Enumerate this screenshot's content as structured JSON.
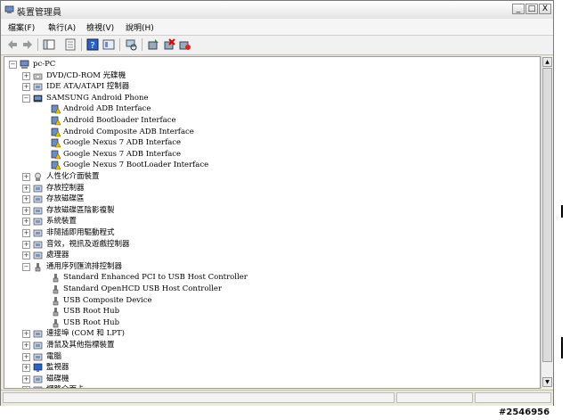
{
  "window": {
    "title": "裝置管理員",
    "buttons": {
      "minimize": "_",
      "maximize": "□",
      "close": "X"
    }
  },
  "menu": [
    {
      "label": "檔案(F)"
    },
    {
      "label": "執行(A)"
    },
    {
      "label": "檢視(V)"
    },
    {
      "label": "說明(H)"
    }
  ],
  "toolbar": [
    {
      "icon": "back-icon"
    },
    {
      "icon": "forward-icon"
    },
    {
      "icon": "console-tree-icon"
    },
    {
      "icon": "properties-list-icon"
    },
    {
      "icon": "help-icon"
    },
    {
      "icon": "view-icon"
    },
    {
      "icon": "scan-hardware-icon"
    },
    {
      "icon": "update-driver-icon"
    },
    {
      "icon": "uninstall-icon"
    },
    {
      "icon": "disable-icon"
    }
  ],
  "tree": {
    "root": "pc-PC",
    "items": [
      {
        "label": "DVD/CD-ROM 光碟機",
        "icon": "dvd-icon",
        "expander": "+"
      },
      {
        "label": "IDE ATA/ATAPI 控制器",
        "icon": "ide-icon",
        "expander": "+"
      },
      {
        "label": "SAMSUNG Android Phone",
        "icon": "phone-icon",
        "expander": "-"
      },
      {
        "label": "Android ADB Interface",
        "icon": "warning-device-icon",
        "child": true
      },
      {
        "label": "Android Bootloader Interface",
        "icon": "warning-device-icon",
        "child": true
      },
      {
        "label": "Android Composite ADB Interface",
        "icon": "warning-device-icon",
        "child": true
      },
      {
        "label": "Google Nexus 7 ADB Interface",
        "icon": "warning-device-icon",
        "child": true
      },
      {
        "label": "Google Nexus 7 ADB Interface",
        "icon": "warning-device-icon",
        "child": true
      },
      {
        "label": "Google Nexus 7 BootLoader Interface",
        "icon": "warning-device-icon",
        "child": true
      },
      {
        "label": "人性化介面裝置",
        "icon": "hid-icon",
        "expander": "+"
      },
      {
        "label": "存放控制器",
        "icon": "storage-controller-icon",
        "expander": "+"
      },
      {
        "label": "存放磁碟區",
        "icon": "volume-icon",
        "expander": "+"
      },
      {
        "label": "存放磁碟區陰影複製",
        "icon": "shadow-copy-icon",
        "expander": "+"
      },
      {
        "label": "系統裝置",
        "icon": "system-device-icon",
        "expander": "+"
      },
      {
        "label": "非隨插即用驅動程式",
        "icon": "driver-icon",
        "expander": "+"
      },
      {
        "label": "音效，視訊及遊戲控制器",
        "icon": "sound-icon",
        "expander": "+"
      },
      {
        "label": "處理器",
        "icon": "processor-icon",
        "expander": "+"
      },
      {
        "label": "通用序列匯流排控制器",
        "icon": "usb-icon",
        "expander": "-"
      },
      {
        "label": "Standard Enhanced PCI to USB Host Controller",
        "icon": "usb-icon",
        "child": true
      },
      {
        "label": "Standard OpenHCD USB Host Controller",
        "icon": "usb-icon",
        "child": true
      },
      {
        "label": "USB Composite Device",
        "icon": "usb-icon",
        "child": true
      },
      {
        "label": "USB Root Hub",
        "icon": "usb-icon",
        "child": true
      },
      {
        "label": "USB Root Hub",
        "icon": "usb-icon",
        "child": true
      },
      {
        "label": "連接埠 (COM 和 LPT)",
        "icon": "port-icon",
        "expander": "+"
      },
      {
        "label": "滑鼠及其他指標裝置",
        "icon": "mouse-icon",
        "expander": "+"
      },
      {
        "label": "電腦",
        "icon": "computer-icon",
        "expander": "+"
      },
      {
        "label": "監視器",
        "icon": "monitor-icon",
        "expander": "+"
      },
      {
        "label": "磁碟機",
        "icon": "disk-icon",
        "expander": "+"
      },
      {
        "label": "網路介面卡",
        "icon": "network-icon",
        "expander": "+"
      }
    ]
  },
  "watermark": "#2546956",
  "colors": {
    "warning": "#e8c400",
    "window_bg": "#ece9d8"
  }
}
